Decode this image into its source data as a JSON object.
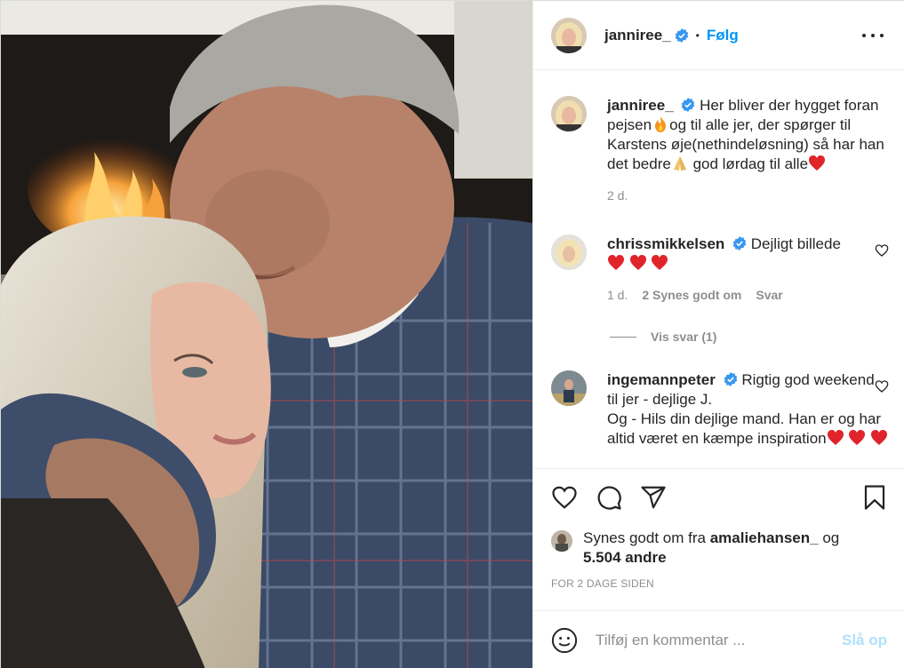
{
  "post": {
    "author": "janniree_",
    "follow_label": "Følg",
    "dot": "•",
    "more_icon": "more-horizontal-icon",
    "verified_icon": "verified-badge-icon",
    "accent_color": "#0095f6"
  },
  "caption": {
    "username": "janniree_",
    "text_part1": "Her bliver der hygget foran pejsen",
    "text_part2": "og til alle jer, der spørger til Karstens øje(nethindeløsning) så har han det bedre",
    "text_part3": " god lørdag til alle",
    "emojis": [
      "fire",
      "folded-hands",
      "red-heart"
    ],
    "age": "2 d."
  },
  "comments": [
    {
      "username": "chrissmikkelsen",
      "text": "Dejligt billede",
      "emojis": [
        "red-heart",
        "red-heart",
        "red-heart"
      ],
      "age": "1 d.",
      "likes": "2 Synes godt om",
      "reply": "Svar",
      "view_replies": "Vis svar (1)"
    },
    {
      "username": "ingemannpeter",
      "text_line1": "Rigtig god weekend til jer - dejlige J.",
      "text_line2": "Og - Hils din dejlige mand. Han er og har altid været en kæmpe inspiration",
      "emojis": [
        "red-heart",
        "red-heart",
        "red-heart"
      ]
    }
  ],
  "actions": {
    "like_icon": "heart-icon",
    "comment_icon": "comment-icon",
    "share_icon": "paper-plane-icon",
    "save_icon": "bookmark-icon"
  },
  "likes": {
    "prefix": "Synes godt om fra",
    "user": "amaliehansen_",
    "joiner": "og",
    "others": "5.504 andre"
  },
  "timestamp": "FOR 2 DAGE SIDEN",
  "add_comment": {
    "placeholder": "Tilføj en kommentar ...",
    "post_label": "Slå op",
    "emoji_icon": "smiley-icon"
  }
}
